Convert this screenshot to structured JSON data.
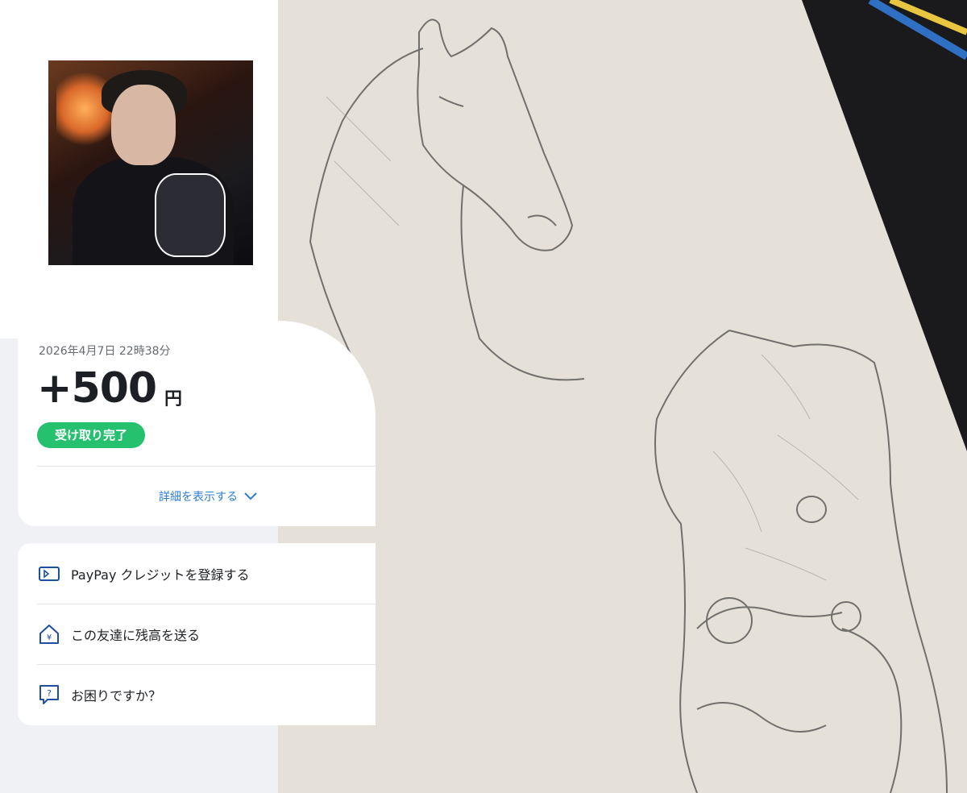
{
  "transaction": {
    "datetime": "2026年4月7日 22時38分",
    "amount": "+500",
    "currency": "円",
    "status": "受け取り完了",
    "details_link": "詳細を表示する"
  },
  "menu": {
    "items": [
      {
        "label": "PayPay クレジットを登録する",
        "icon": "credit-card-icon"
      },
      {
        "label": "この友達に残高を送る",
        "icon": "send-balance-icon"
      },
      {
        "label": "お困りですか？",
        "icon": "help-icon"
      }
    ]
  },
  "colors": {
    "status_green": "#25c16e",
    "link_blue": "#2d7dd2",
    "icon_blue": "#1f4fa0",
    "panel_bg": "#f0f1f4"
  }
}
